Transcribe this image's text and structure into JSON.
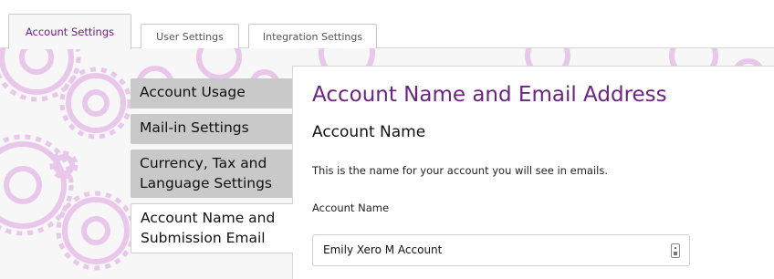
{
  "tabs": [
    {
      "label": "Account Settings",
      "active": true
    },
    {
      "label": "User Settings",
      "active": false
    },
    {
      "label": "Integration Settings",
      "active": false
    }
  ],
  "menu": [
    {
      "label": "Account Usage"
    },
    {
      "label": "Mail-in Settings"
    },
    {
      "label": "Currency, Tax and Language Settings"
    },
    {
      "label": "Account Name and Submission Email",
      "active": true
    }
  ],
  "panel": {
    "title": "Account Name and Email Address",
    "section_title": "Account Name",
    "description": "This is the name for your account you will see in emails.",
    "field_label": "Account Name",
    "field_value": "Emily Xero M Account"
  },
  "colors": {
    "accent": "#6b2480",
    "menu_bg": "#c9c9c9",
    "pattern": "#e8c7ea"
  }
}
